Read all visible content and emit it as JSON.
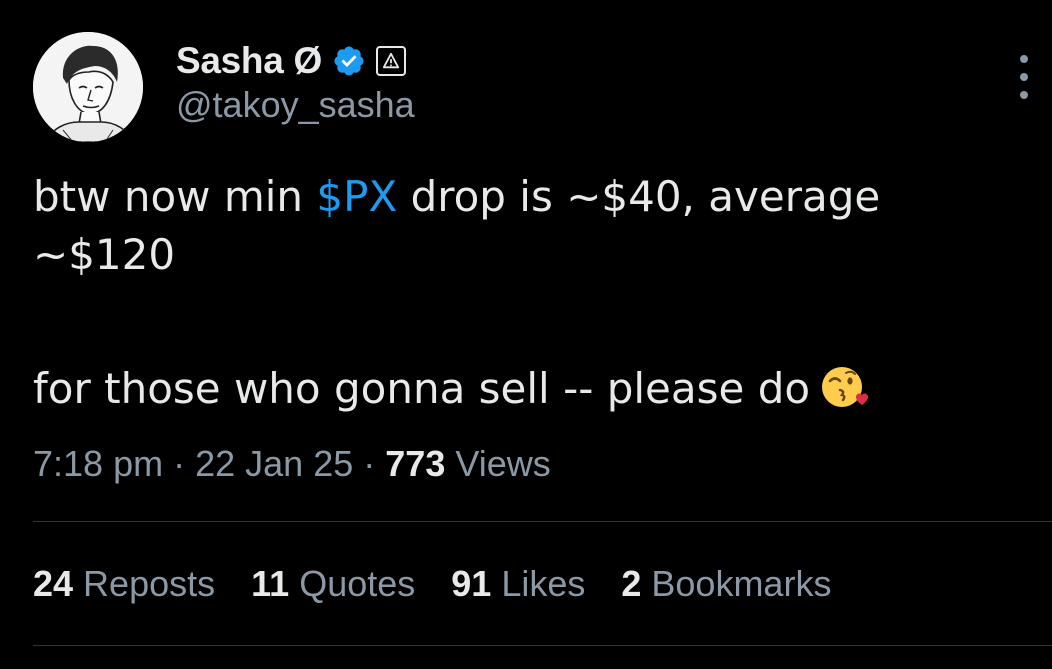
{
  "author": {
    "display_name": "Sasha Ø",
    "handle": "@takoy_sasha",
    "verified_icon": "verified-badge-icon",
    "badge_icon": "affiliate-warning-icon"
  },
  "tweet": {
    "line1_prefix": "btw now min ",
    "cashtag": "$PX",
    "line1_suffix": " drop is ~$40, average",
    "line2": "~$120",
    "line3": "for those who gonna sell -- please do",
    "emoji": "face-blowing-kiss-emoji"
  },
  "meta": {
    "time": "7:18 pm",
    "sep1": "·",
    "date": "22 Jan 25",
    "sep2": "·",
    "views_count": "773",
    "views_label": "Views"
  },
  "stats": [
    {
      "count": "24",
      "label": "Reposts"
    },
    {
      "count": "11",
      "label": "Quotes"
    },
    {
      "count": "91",
      "label": "Likes"
    },
    {
      "count": "2",
      "label": "Bookmarks"
    }
  ],
  "colors": {
    "background": "#000000",
    "text": "#e7e9ea",
    "secondary": "#8b98a5",
    "accent": "#1d9bf0",
    "divider": "#2f3336"
  }
}
